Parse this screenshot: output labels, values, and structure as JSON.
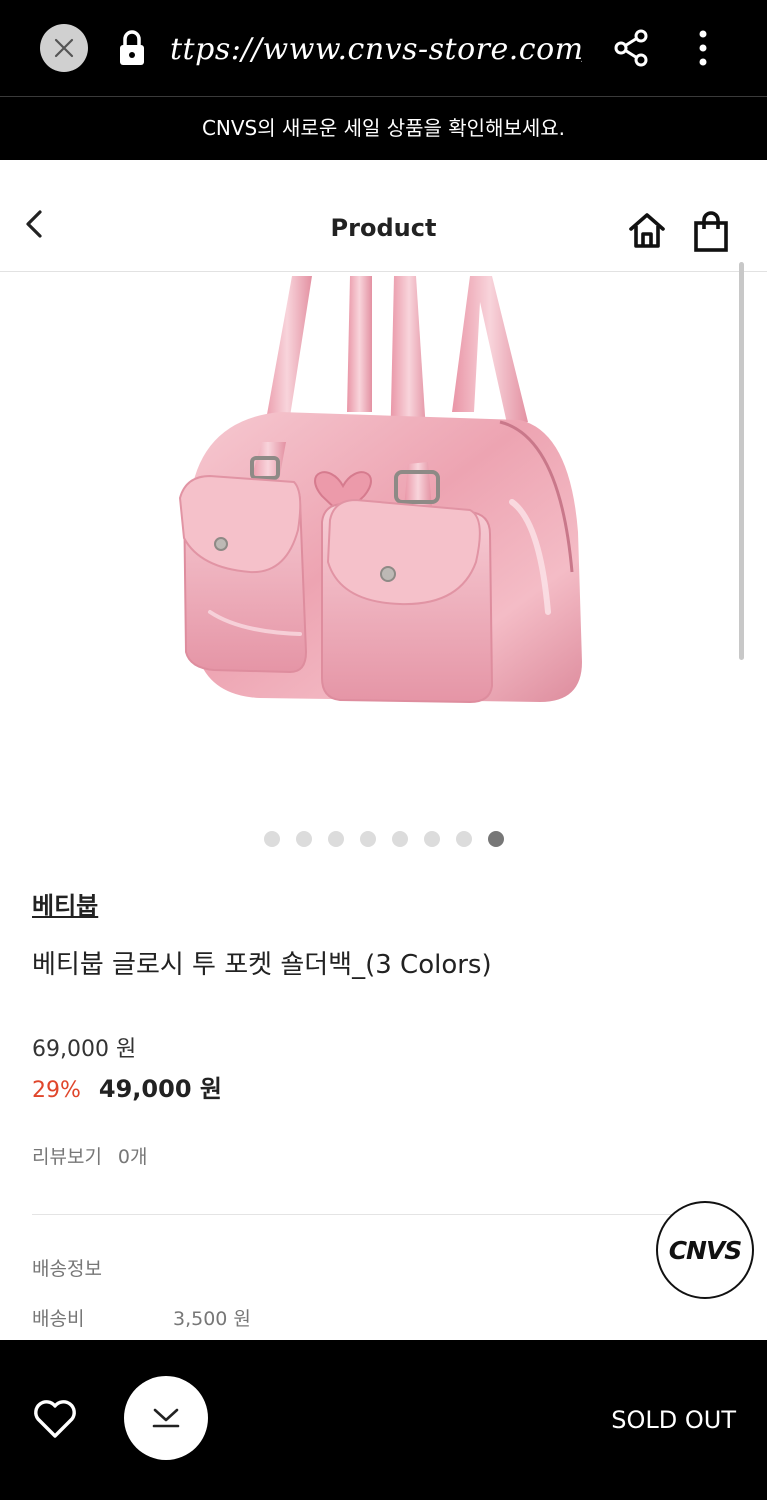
{
  "browser": {
    "url": "ttps://www.cnvs-store.com/p",
    "icons": [
      "close-icon",
      "lock-icon",
      "share-icon",
      "more-vertical-icon"
    ]
  },
  "banner": {
    "text": "CNVS의 새로운 세일 상품을 확인해보세요."
  },
  "header": {
    "title": "Product",
    "icons": [
      "back-icon",
      "home-icon",
      "shopping-bag-icon"
    ]
  },
  "gallery": {
    "total": 8,
    "active_index": 8
  },
  "product": {
    "brand": "베티붑",
    "name": "베티붑 글로시 투 포켓 숄더백_(3 Colors)",
    "original_price": "69,000 원",
    "discount": "29%",
    "sale_price": "49,000 원",
    "review_label": "리뷰보기",
    "review_count": "0개"
  },
  "shipping": {
    "title": "배송정보",
    "fee_label": "배송비",
    "fee_value": "3,500 원"
  },
  "floating": {
    "logo": "CNVS"
  },
  "bottom_bar": {
    "soldout_label": "SOLD OUT",
    "icons": [
      "heart-icon",
      "chevron-down-icon"
    ]
  },
  "colors": {
    "discount": "#e0462b",
    "bar_background": "#000000",
    "bag_pink": "#f3b8c2"
  }
}
